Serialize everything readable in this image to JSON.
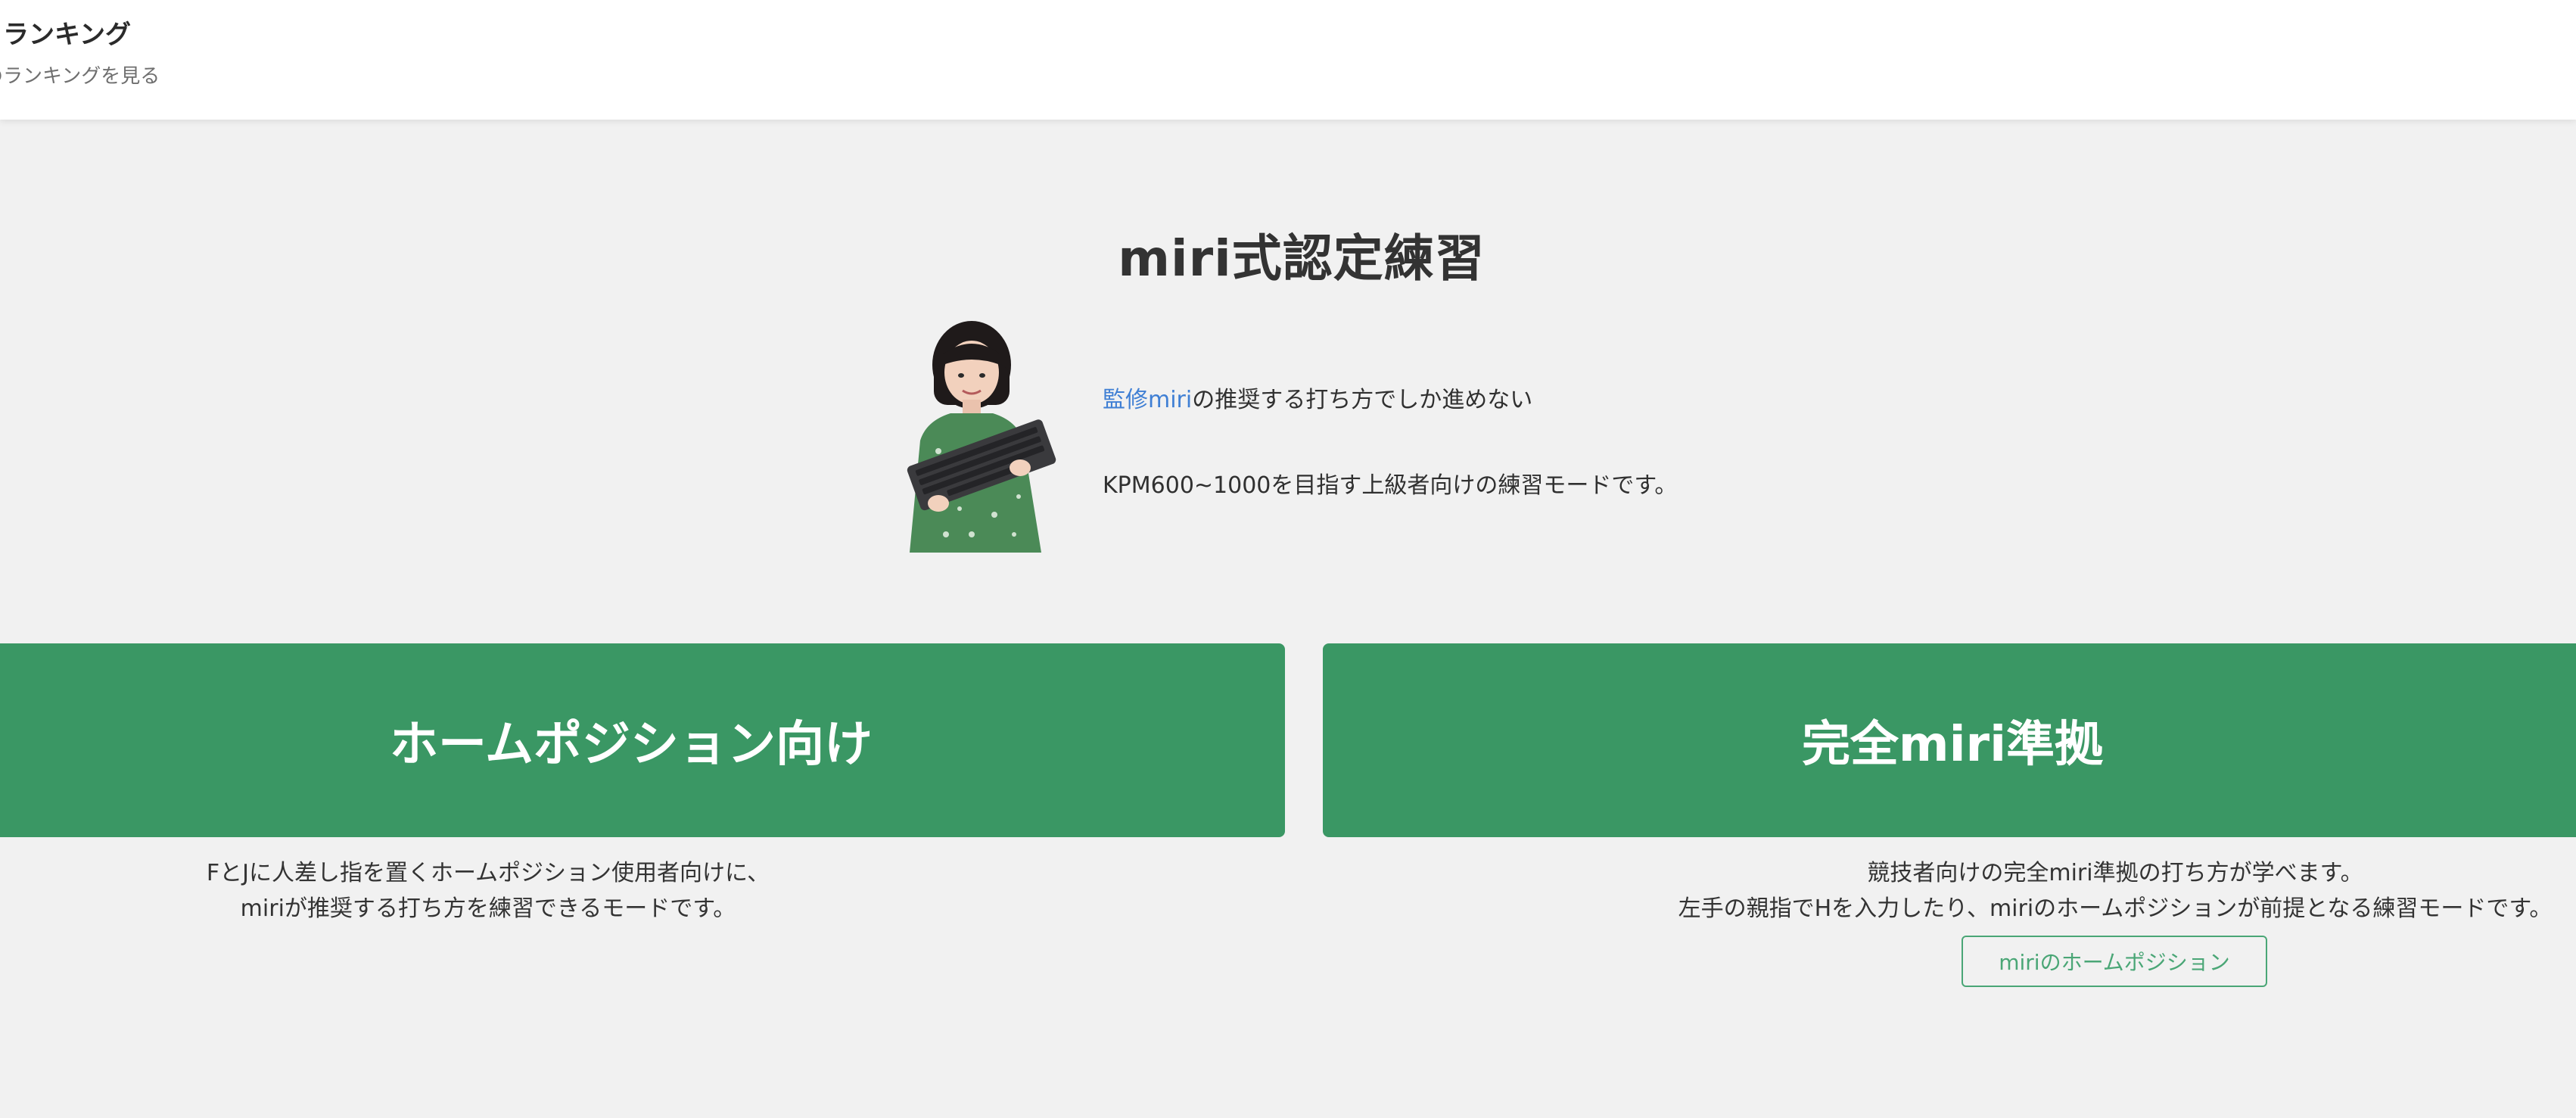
{
  "header": {
    "title": "カランキング",
    "subtitle": "のランキングを見る"
  },
  "page": {
    "title": "miri式認定練習"
  },
  "intro": {
    "supervisor_link": "監修miri",
    "line1_suffix": "の推奨する打ち方でしか進めない",
    "line2": "KPM600~1000を目指す上級者向けの練習モードです。"
  },
  "modes": [
    {
      "label": "ホームポジション向け",
      "description_lines": [
        "FとJに人差し指を置くホームポジション使用者向けに、",
        "miriが推奨する打ち方を練習できるモードです。"
      ]
    },
    {
      "label": "完全miri準拠",
      "description_lines": [
        "競技者向けの完全miri準拠の打ち方が学べます。",
        "左手の親指でHを入力したり、miriのホームポジションが前提となる練習モードです。"
      ],
      "button_label": "miriのホームポジション"
    }
  ],
  "colors": {
    "accent_green": "#3a9764",
    "link_blue": "#3f7fd4",
    "background": "#f1f1f1"
  }
}
